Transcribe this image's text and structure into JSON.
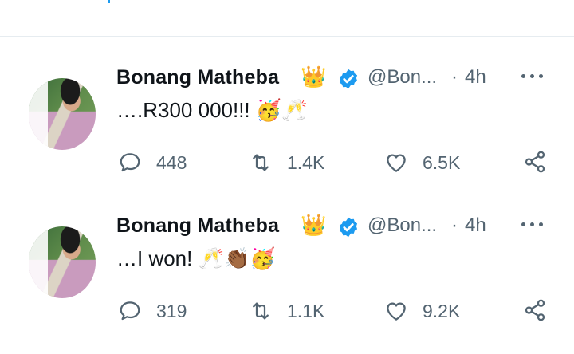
{
  "colors": {
    "accent": "#1d9bf0",
    "muted": "#536471",
    "text": "#0f1419",
    "divider": "#e6ecf0"
  },
  "tweets": [
    {
      "name": "Bonang Matheba",
      "name_emoji": "👑",
      "handle": "@Bon...",
      "separator": "·",
      "time": "4h",
      "text": "….R300 000!!!",
      "text_emoji": "🥳🥂",
      "replies": "448",
      "retweets": "1.4K",
      "likes": "6.5K"
    },
    {
      "name": "Bonang Matheba",
      "name_emoji": "👑",
      "handle": "@Bon...",
      "separator": "·",
      "time": "4h",
      "text": "…I won!",
      "text_emoji": "🥂👏🏾🥳",
      "replies": "319",
      "retweets": "1.1K",
      "likes": "9.2K"
    }
  ]
}
